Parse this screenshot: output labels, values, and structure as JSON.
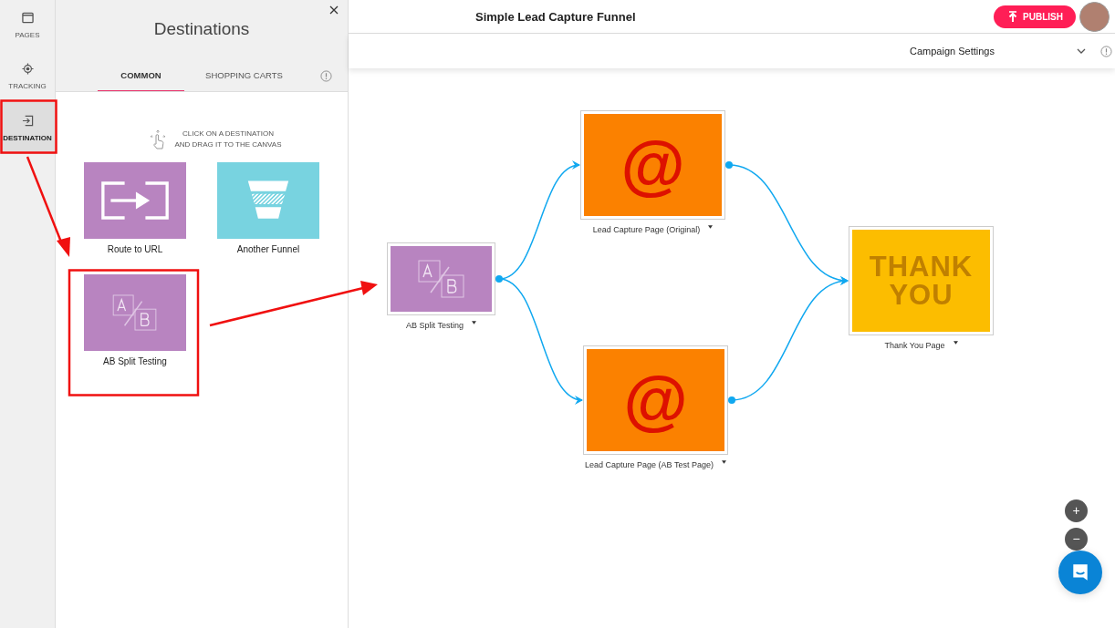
{
  "rail": [
    {
      "label": "PAGES",
      "kind": "page",
      "selected": false
    },
    {
      "label": "TRACKING",
      "kind": "target",
      "selected": false
    },
    {
      "label": "DESTINATION",
      "kind": "enter",
      "selected": true
    }
  ],
  "panel": {
    "title": "Destinations",
    "tabs": [
      {
        "label": "COMMON",
        "selected": true
      },
      {
        "label": "SHOPPING CARTS",
        "selected": false
      }
    ],
    "hint": "CLICK ON A DESTINATION\nAND DRAG IT TO THE CANVAS",
    "destinations": [
      {
        "label": "Route to URL",
        "kind": "route"
      },
      {
        "label": "Another Funnel",
        "kind": "funnel"
      },
      {
        "label": "AB Split Testing",
        "kind": "ab"
      }
    ]
  },
  "header": {
    "title": "Simple Lead Capture Funnel",
    "publish": "PUBLISH"
  },
  "settings": {
    "label": "Campaign Settings"
  },
  "canvas": {
    "nodes": [
      {
        "label": "AB Split Testing",
        "kind": "ab"
      },
      {
        "label": "Lead Capture Page (Original)",
        "kind": "optin",
        "glyph": "@"
      },
      {
        "label": "Lead Capture Page (AB Test Page)",
        "kind": "optin",
        "glyph": "@"
      },
      {
        "label": "Thank You Page",
        "kind": "thanks",
        "glyph": "THANK YOU"
      }
    ],
    "zoom": [
      "+",
      "−"
    ]
  }
}
